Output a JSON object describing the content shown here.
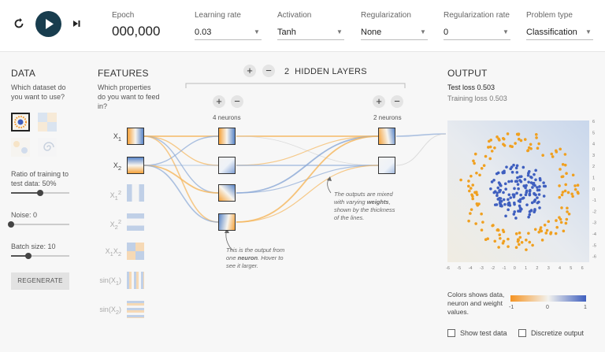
{
  "controls": {
    "epoch_label": "Epoch",
    "epoch_value": "000,000",
    "learning_rate_label": "Learning rate",
    "learning_rate_value": "0.03",
    "activation_label": "Activation",
    "activation_value": "Tanh",
    "regularization_label": "Regularization",
    "regularization_value": "None",
    "reg_rate_label": "Regularization rate",
    "reg_rate_value": "0",
    "problem_type_label": "Problem type",
    "problem_type_value": "Classification"
  },
  "data_panel": {
    "heading": "DATA",
    "question": "Which dataset do you want to use?",
    "ratio_label": "Ratio of training to test data:",
    "ratio_value": "50%",
    "ratio_fraction": 0.5,
    "noise_label": "Noise:",
    "noise_value": "0",
    "noise_fraction": 0.0,
    "batch_label": "Batch size:",
    "batch_value": "10",
    "batch_fraction": 0.3,
    "regenerate": "REGENERATE"
  },
  "features_panel": {
    "heading": "FEATURES",
    "question": "Which properties do you want to feed in?",
    "features": [
      {
        "base": "X",
        "sub": "1",
        "sup": "",
        "active": true
      },
      {
        "base": "X",
        "sub": "2",
        "sup": "",
        "active": true
      },
      {
        "base": "X",
        "sub": "1",
        "sup": "2",
        "active": false
      },
      {
        "base": "X",
        "sub": "2",
        "sup": "2",
        "active": false
      },
      {
        "base": "X",
        "sub": "1",
        "sup": "",
        "extra": "X",
        "extra_sub": "2",
        "active": false
      },
      {
        "text": "sin(X",
        "sub": "1",
        "tail": ")",
        "active": false
      },
      {
        "text": "sin(X",
        "sub": "2",
        "tail": ")",
        "active": false
      }
    ]
  },
  "network": {
    "hidden_layers_count": "2",
    "hidden_layers_label": "HIDDEN LAYERS",
    "layer1_label": "4 neurons",
    "layer2_label": "2 neurons",
    "annotation1_parts": [
      "This is the output from one ",
      "neuron",
      ". Hover to see it larger."
    ],
    "annotation2_parts": [
      "The outputs are mixed with varying ",
      "weights",
      ", shown by the thickness of the lines."
    ]
  },
  "output_panel": {
    "heading": "OUTPUT",
    "test_loss_label": "Test loss",
    "test_loss_value": "0.503",
    "training_loss_label": "Training loss",
    "training_loss_value": "0.503",
    "y_ticks": [
      "6",
      "5",
      "4",
      "3",
      "2",
      "1",
      "0",
      "-1",
      "-2",
      "-3",
      "-4",
      "-5",
      "-6"
    ],
    "x_ticks": [
      "-6",
      "-5",
      "-4",
      "-3",
      "-2",
      "-1",
      "0",
      "1",
      "2",
      "3",
      "4",
      "5",
      "6"
    ],
    "colors_note": "Colors shows data, neuron and weight values.",
    "legend_ticks": [
      "-1",
      "0",
      "1"
    ],
    "show_test_data": "Show test data",
    "discretize_output": "Discretize output"
  },
  "colors": {
    "orange": "#f59322",
    "blue": "#0877bd",
    "point_blue": "#3f5fbf",
    "point_orange": "#f0a020"
  },
  "icons": {
    "reset": "reset-icon",
    "play": "play-icon",
    "step": "step-forward-icon"
  }
}
